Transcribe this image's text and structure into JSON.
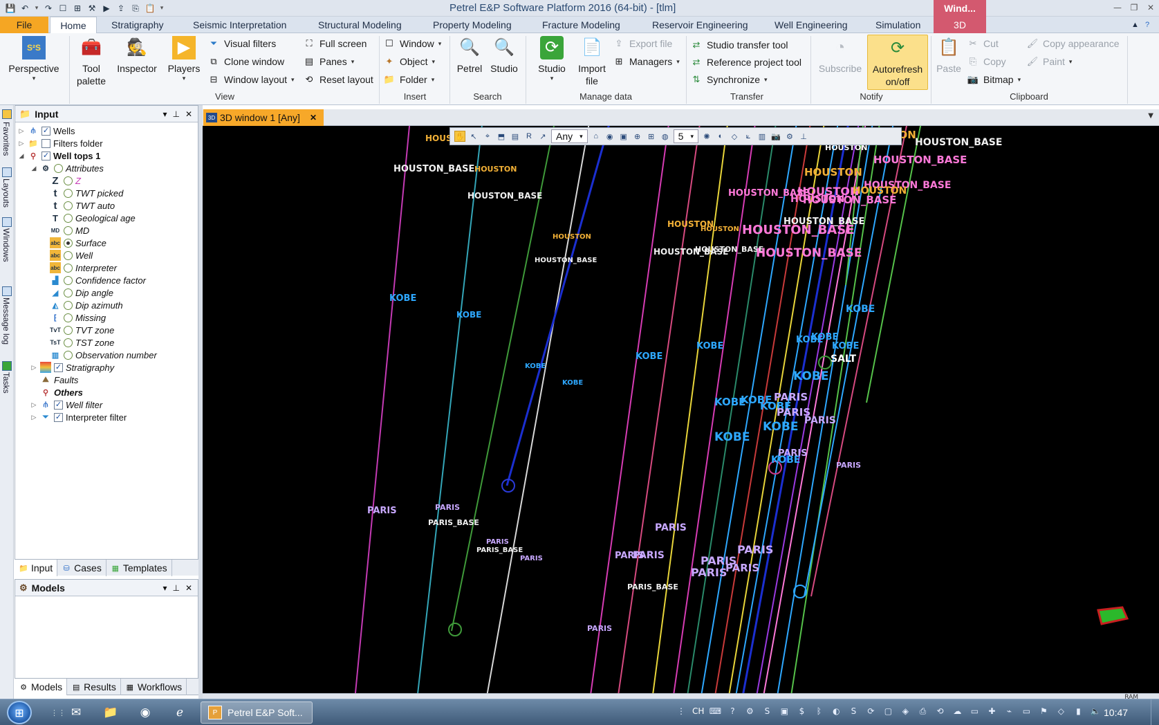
{
  "titlebar": {
    "title": "Petrel E&P Software Platform 2016 (64-bit) - [tlm]",
    "context_tag": "Wind...",
    "qat_icons": [
      "save-icon",
      "undo-icon",
      "undo-dropdown-icon",
      "redo-icon",
      "new-window-icon",
      "layout-icon",
      "tool-icon",
      "player-icon",
      "export-icon",
      "copy-icon",
      "paste-icon",
      "customize-icon"
    ]
  },
  "tabs": {
    "file": "File",
    "home": "Home",
    "stratigraphy": "Stratigraphy",
    "seismic": "Seismic Interpretation",
    "structural": "Structural Modeling",
    "property": "Property Modeling",
    "fracture": "Fracture Modeling",
    "reservoir": "Reservoir Engineering",
    "well": "Well Engineering",
    "simulation": "Simulation",
    "threed": "3D"
  },
  "ribbon": {
    "perspective": "Perspective",
    "tool_palette_1": "Tool",
    "tool_palette_2": "palette",
    "inspector": "Inspector",
    "players": "Players",
    "visual_filters": "Visual filters",
    "clone_window": "Clone window",
    "window_layout": "Window layout",
    "full_screen": "Full screen",
    "panes": "Panes",
    "reset_layout": "Reset layout",
    "window": "Window",
    "object": "Object",
    "folder": "Folder",
    "petrel": "Petrel",
    "studio_search": "Studio",
    "studio": "Studio",
    "import_file_1": "Import",
    "import_file_2": "file",
    "export_file": "Export file",
    "managers": "Managers",
    "studio_transfer": "Studio transfer tool",
    "reference_project": "Reference project tool",
    "synchronize": "Synchronize",
    "subscribe": "Subscribe",
    "autorefresh_1": "Autorefresh",
    "autorefresh_2": "on/off",
    "paste": "Paste",
    "cut": "Cut",
    "copy": "Copy",
    "bitmap": "Bitmap",
    "copy_appearance": "Copy appearance",
    "paint": "Paint",
    "groups": {
      "view": "View",
      "insert": "Insert",
      "search": "Search",
      "manage": "Manage data",
      "transfer": "Transfer",
      "notify": "Notify",
      "clipboard": "Clipboard"
    }
  },
  "sidestrip": {
    "favorites": "Favorites",
    "layouts": "Layouts",
    "windows": "Windows",
    "message_log": "Message log",
    "tasks": "Tasks"
  },
  "input_pane": {
    "title": "Input",
    "tree": {
      "wells": "Wells",
      "filters_folder": "Filters folder",
      "well_tops": "Well tops 1",
      "attributes": "Attributes",
      "z": "Z",
      "twt_picked": "TWT picked",
      "twt_auto": "TWT auto",
      "geological_age": "Geological age",
      "md": "MD",
      "surface": "Surface",
      "well": "Well",
      "interpreter": "Interpreter",
      "confidence": "Confidence factor",
      "dip_angle": "Dip angle",
      "dip_azimuth": "Dip azimuth",
      "missing": "Missing",
      "tvt_zone": "TVT zone",
      "tst_zone": "TST zone",
      "observation": "Observation number",
      "stratigraphy": "Stratigraphy",
      "faults": "Faults",
      "others": "Others",
      "well_filter": "Well filter",
      "interpreter_filter": "Interpreter filter"
    },
    "tabs": {
      "input": "Input",
      "cases": "Cases",
      "templates": "Templates"
    }
  },
  "models_pane": {
    "title": "Models",
    "tabs": {
      "models": "Models",
      "results": "Results",
      "workflows": "Workflows"
    }
  },
  "document": {
    "tab_label": "3D window 1 [Any]",
    "toolbar_select": "Any",
    "toolbar_number": "5",
    "status_ram": "RAM"
  },
  "viewport": {
    "labels": [
      {
        "text": "HOUSTON",
        "c": "#f2b036"
      },
      {
        "text": "HOUSTON_BASE",
        "c": "#f0f0f0"
      },
      {
        "text": "HOUSTON",
        "c": "#f2b036"
      },
      {
        "text": "HOUSTON_BASE",
        "c": "#f0f0f0"
      },
      {
        "text": "HOUSTON",
        "c": "#f2b036"
      },
      {
        "text": "HOUSTON_BASE",
        "c": "#f0f0f0"
      },
      {
        "text": "KOBE",
        "c": "#2ea8ff"
      },
      {
        "text": "KOBE",
        "c": "#2ea8ff"
      },
      {
        "text": "KOBE",
        "c": "#2ea8ff"
      },
      {
        "text": "KOBE",
        "c": "#2ea8ff"
      },
      {
        "text": "PARIS",
        "c": "#c8a8ff"
      },
      {
        "text": "PARIS",
        "c": "#c8a8ff"
      },
      {
        "text": "PARIS_BASE",
        "c": "#f0f0f0"
      },
      {
        "text": "PARIS",
        "c": "#c8a8ff"
      },
      {
        "text": "PARIS_BASE",
        "c": "#f0f0f0"
      },
      {
        "text": "PARIS",
        "c": "#c8a8ff"
      },
      {
        "text": "HOUSTON",
        "c": "#f2b036"
      },
      {
        "text": "HOUSTON",
        "c": "#f2b036"
      },
      {
        "text": "HOUSTON_BASE",
        "c": "#f0f0f0"
      },
      {
        "text": "HOUSTON_BASE",
        "c": "#f0f0f0"
      },
      {
        "text": "HOUSTON_BASE",
        "c": "#f0f0f0"
      },
      {
        "text": "HOUSTON_BASE",
        "c": "#ff79d9"
      },
      {
        "text": "HOUSTON_BASE",
        "c": "#ff79d9"
      },
      {
        "text": "HOUSTON",
        "c": "#f2b036"
      },
      {
        "text": "HOUSTON",
        "c": "#ff79d9"
      },
      {
        "text": "HOUSTON_BASE",
        "c": "#ff79d9"
      },
      {
        "text": "HOUSTON_BASE",
        "c": "#ff79d9"
      },
      {
        "text": "HOUSTON",
        "c": "#ffffff"
      },
      {
        "text": "HOUSTON",
        "c": "#f2b036"
      },
      {
        "text": "HOUSTON",
        "c": "#f2b036"
      },
      {
        "text": "HOUSTON_BASE",
        "c": "#ff79d9"
      },
      {
        "text": "HOUSTON_BASE",
        "c": "#ff79d9"
      },
      {
        "text": "HOUSTON",
        "c": "#ff79d9"
      },
      {
        "text": "HOUSTON_BASE",
        "c": "#f0f0f0"
      },
      {
        "text": "KOBE",
        "c": "#2ea8ff"
      },
      {
        "text": "KOBE",
        "c": "#2ea8ff"
      },
      {
        "text": "KOBE",
        "c": "#2ea8ff"
      },
      {
        "text": "KOBE",
        "c": "#2ea8ff"
      },
      {
        "text": "KOBE",
        "c": "#2ea8ff"
      },
      {
        "text": "KOBE",
        "c": "#2ea8ff"
      },
      {
        "text": "KOBE",
        "c": "#2ea8ff"
      },
      {
        "text": "KOBE",
        "c": "#2ea8ff"
      },
      {
        "text": "KOBE",
        "c": "#2ea8ff"
      },
      {
        "text": "KOBE",
        "c": "#2ea8ff"
      },
      {
        "text": "KOBE",
        "c": "#2ea8ff"
      },
      {
        "text": "KOBE",
        "c": "#2ea8ff"
      },
      {
        "text": "KOBE",
        "c": "#2ea8ff"
      },
      {
        "text": "SALT",
        "c": "#ffffff"
      },
      {
        "text": "PARIS",
        "c": "#c8a8ff"
      },
      {
        "text": "PARIS",
        "c": "#c8a8ff"
      },
      {
        "text": "PARIS",
        "c": "#c8a8ff"
      },
      {
        "text": "PARIS",
        "c": "#c8a8ff"
      },
      {
        "text": "PARIS",
        "c": "#c8a8ff"
      },
      {
        "text": "PARIS",
        "c": "#c8a8ff"
      },
      {
        "text": "PARIS",
        "c": "#c8a8ff"
      },
      {
        "text": "PARIS",
        "c": "#c8a8ff"
      },
      {
        "text": "PARIS",
        "c": "#c8a8ff"
      },
      {
        "text": "PARIS",
        "c": "#c8a8ff"
      },
      {
        "text": "PARIS",
        "c": "#c8a8ff"
      },
      {
        "text": "PARIS",
        "c": "#c8a8ff"
      },
      {
        "text": "PARIS",
        "c": "#c8a8ff"
      },
      {
        "text": "PARIS_BASE",
        "c": "#f0f0f0"
      }
    ],
    "well_colors": [
      "#c43ab4",
      "#34a6b8",
      "#3f9a3a",
      "#d8d8d8",
      "#1b2fd0",
      "#d63cb4",
      "#d64a80",
      "#e8d53a",
      "#2a8a6a",
      "#2ea8ff",
      "#c93a3a",
      "#9a3ae0",
      "#ff79d9",
      "#56c24a",
      "#f0f0f0"
    ]
  },
  "taskbar": {
    "app_label": "Petrel E&P Soft...",
    "lang": "CH",
    "time": "10:47"
  }
}
